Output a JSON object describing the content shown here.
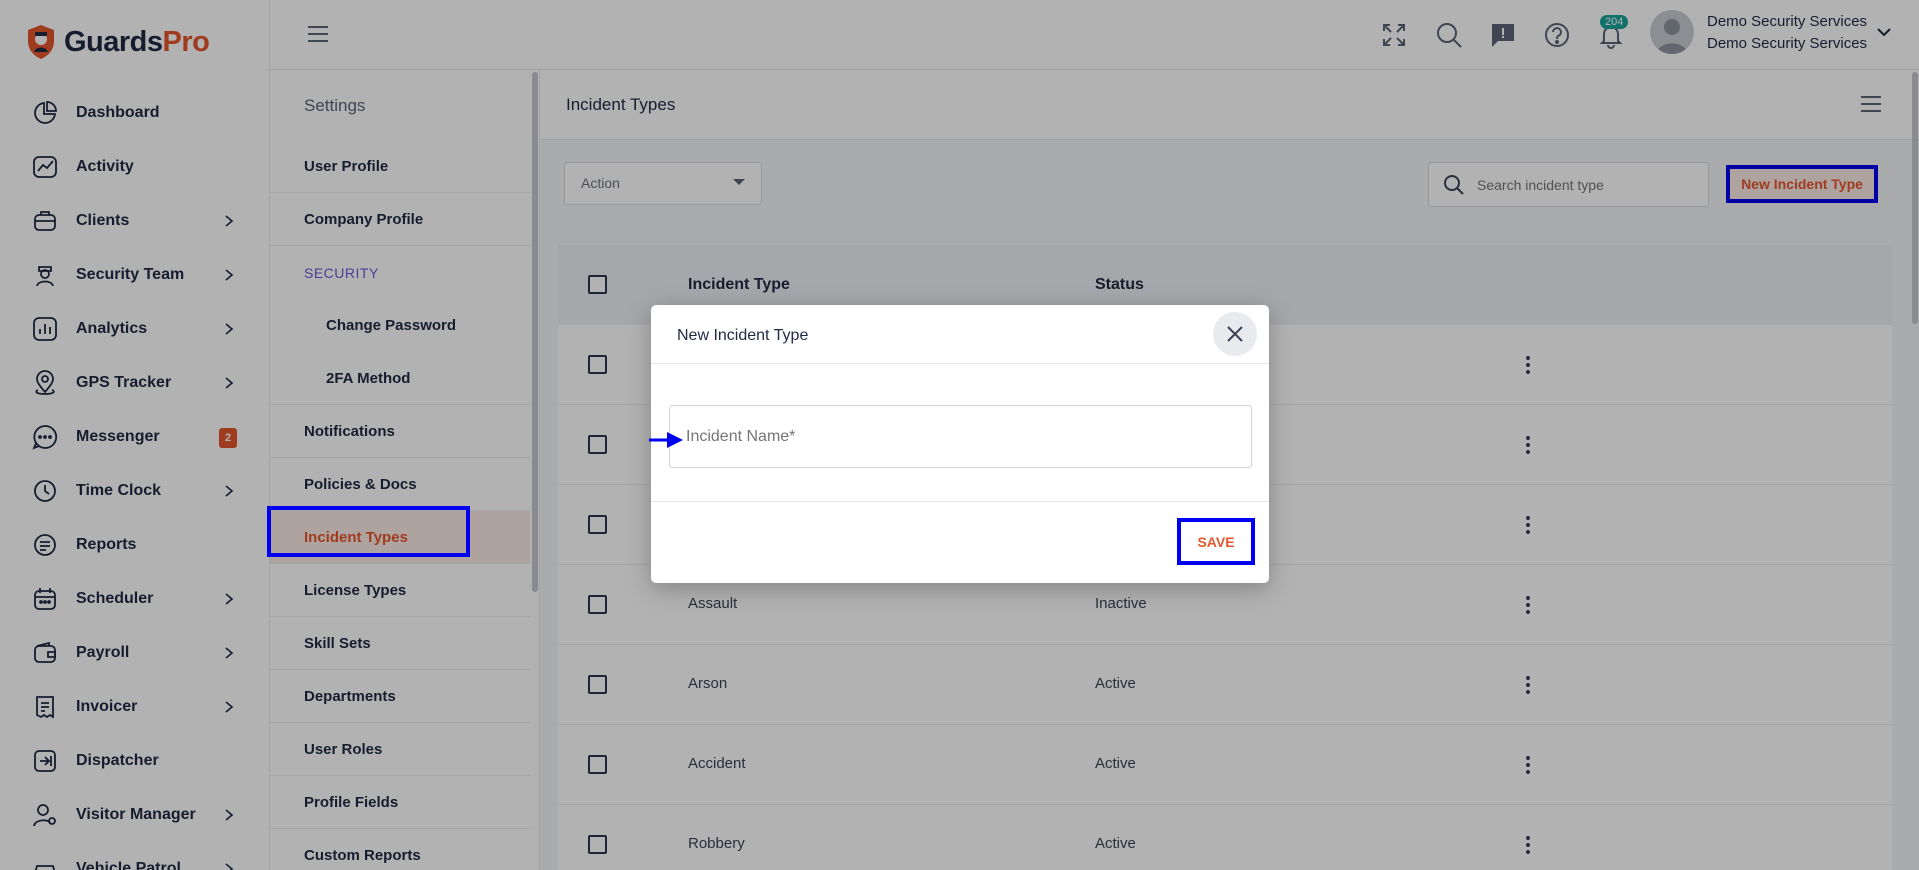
{
  "app": {
    "logo_part1": "Guards",
    "logo_part2": "Pro"
  },
  "sidebar": {
    "items": [
      {
        "label": "Dashboard",
        "icon": "dashboard-icon",
        "has_chevron": false
      },
      {
        "label": "Activity",
        "icon": "activity-icon",
        "has_chevron": false
      },
      {
        "label": "Clients",
        "icon": "clients-icon",
        "has_chevron": true
      },
      {
        "label": "Security Team",
        "icon": "security-team-icon",
        "has_chevron": true
      },
      {
        "label": "Analytics",
        "icon": "analytics-icon",
        "has_chevron": true
      },
      {
        "label": "GPS Tracker",
        "icon": "gps-pin-icon",
        "has_chevron": true
      },
      {
        "label": "Messenger",
        "icon": "chat-icon",
        "badge": "2"
      },
      {
        "label": "Time Clock",
        "icon": "clock-icon",
        "has_chevron": true
      },
      {
        "label": "Reports",
        "icon": "reports-icon",
        "has_chevron": false
      },
      {
        "label": "Scheduler",
        "icon": "calendar-icon",
        "has_chevron": true
      },
      {
        "label": "Payroll",
        "icon": "wallet-icon",
        "has_chevron": true
      },
      {
        "label": "Invoicer",
        "icon": "invoice-icon",
        "has_chevron": true
      },
      {
        "label": "Dispatcher",
        "icon": "dispatch-icon",
        "has_chevron": false
      },
      {
        "label": "Visitor Manager",
        "icon": "visitor-icon",
        "has_chevron": true
      },
      {
        "label": "Vehicle Patrol",
        "icon": "vehicle-icon",
        "has_chevron": true
      }
    ]
  },
  "header": {
    "icons": [
      "fullscreen-icon",
      "search-icon",
      "feedback-icon",
      "help-icon",
      "bell-icon"
    ],
    "notification_count": "204",
    "user_name": "Demo Security Services",
    "company_name": "Demo Security Services"
  },
  "settings": {
    "title": "Settings",
    "items": [
      {
        "label": "User Profile",
        "kind": "item"
      },
      {
        "label": "Company Profile",
        "kind": "item"
      },
      {
        "label": "SECURITY",
        "kind": "group"
      },
      {
        "label": "Change Password",
        "kind": "sub"
      },
      {
        "label": "2FA Method",
        "kind": "sub"
      },
      {
        "label": "Notifications",
        "kind": "item"
      },
      {
        "label": "Policies & Docs",
        "kind": "item"
      },
      {
        "label": "Incident Types",
        "kind": "item",
        "active": true
      },
      {
        "label": "License Types",
        "kind": "item"
      },
      {
        "label": "Skill Sets",
        "kind": "item"
      },
      {
        "label": "Departments",
        "kind": "item"
      },
      {
        "label": "User Roles",
        "kind": "item"
      },
      {
        "label": "Profile Fields",
        "kind": "item"
      },
      {
        "label": "Custom Reports",
        "kind": "item"
      }
    ]
  },
  "main": {
    "title": "Incident Types",
    "action_select": "Action",
    "search_placeholder": "Search incident type",
    "new_button": "New Incident Type",
    "table": {
      "columns": [
        "Incident Type",
        "Status"
      ],
      "rows": [
        {
          "name": "",
          "status": ""
        },
        {
          "name": "",
          "status": ""
        },
        {
          "name": "",
          "status": ""
        },
        {
          "name": "Assault",
          "status": "Inactive"
        },
        {
          "name": "Arson",
          "status": "Active"
        },
        {
          "name": "Accident",
          "status": "Active"
        },
        {
          "name": "Robbery",
          "status": "Active"
        }
      ]
    }
  },
  "modal": {
    "title": "New Incident Type",
    "input_placeholder": "Incident Name*",
    "save_label": "SAVE"
  },
  "colors": {
    "brand": "#e4572e",
    "navy": "#1f2a44",
    "highlight": "#0000ee",
    "teal_badge": "#1aa39a"
  }
}
